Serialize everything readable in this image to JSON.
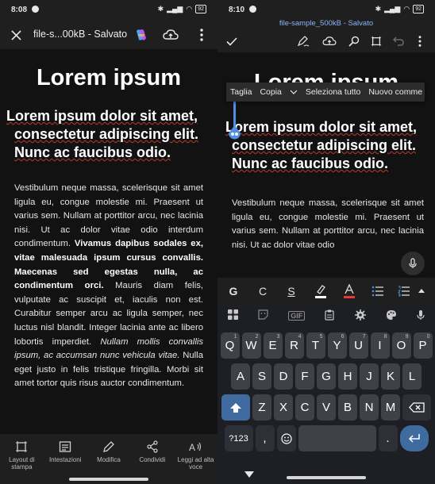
{
  "left": {
    "status": {
      "time": "8:08",
      "battery": "92"
    },
    "appbar": {
      "title": "file-s...00kB - Salvato"
    },
    "doc": {
      "title": "Lorem ipsum",
      "heading": "Lorem ipsum dolor sit amet, consectetur adipiscing elit. Nunc ac faucibus odio.",
      "para_a": "Vestibulum neque massa, scelerisque sit amet ligula eu, congue molestie mi. Praesent ut varius sem. Nullam at porttitor arcu, nec lacinia nisi. Ut ac dolor vitae odio interdum condimentum. ",
      "para_b": "Vivamus dapibus sodales ex, vitae malesuada ipsum cursus convallis. Maecenas sed egestas nulla, ac condimentum orci.",
      "para_c": " Mauris diam felis, vulputate ac suscipit et, iaculis non est. Curabitur semper arcu ac ligula semper, nec luctus nisl blandit. Integer lacinia ante ac libero lobortis imperdiet. ",
      "para_d": "Nullam mollis convallis ipsum, ac accumsan nunc vehicula vitae.",
      "para_e": " Nulla eget justo in felis tristique fringilla. Morbi sit amet tortor quis risus auctor condimentum."
    },
    "bottom_bar": [
      {
        "label": "Layout di stampa",
        "icon": "print-layout-icon"
      },
      {
        "label": "Intestazioni",
        "icon": "headings-icon"
      },
      {
        "label": "Modifica",
        "icon": "edit-pencil-icon"
      },
      {
        "label": "Condividi",
        "icon": "share-icon"
      },
      {
        "label": "Leggi ad alta voce",
        "icon": "read-aloud-icon"
      }
    ]
  },
  "right": {
    "status": {
      "time": "8:10",
      "battery": "92"
    },
    "appbar": {
      "title": "file-sample_500kB - Salvato"
    },
    "context_menu": [
      "Taglia",
      "Copia",
      "Seleziona tutto",
      "Nuovo comme"
    ],
    "doc": {
      "title": "Lorem ipsum",
      "heading": "Lorem ipsum dolor sit amet, consectetur adipiscing elit. Nunc ac faucibus odio.",
      "para": "Vestibulum neque massa, scelerisque sit amet ligula eu, congue molestie mi. Praesent ut varius sem. Nullam at porttitor arcu, nec lacinia nisi. Ut ac dolor vitae odio"
    },
    "format_bar": {
      "bold": "G",
      "italic": "C",
      "strike": "S"
    },
    "keyboard": {
      "toolbar": {
        "gif": "GIF"
      },
      "row1": [
        "Q",
        "W",
        "E",
        "R",
        "T",
        "Y",
        "U",
        "I",
        "O",
        "P"
      ],
      "row1_hints": [
        "1",
        "2",
        "3",
        "4",
        "5",
        "6",
        "7",
        "8",
        "9",
        "0"
      ],
      "row2": [
        "A",
        "S",
        "D",
        "F",
        "G",
        "H",
        "J",
        "K",
        "L"
      ],
      "row3": [
        "Z",
        "X",
        "C",
        "V",
        "B",
        "N",
        "M"
      ],
      "numbers_key": "?123",
      "comma_key": ",",
      "period_key": "."
    }
  },
  "colors": {
    "selection_handle": "#4f8fe6",
    "appbar_title_right": "#8ab4f8",
    "spellcheck": "#c0392b",
    "keyboard_bg": "#1d1f24"
  }
}
